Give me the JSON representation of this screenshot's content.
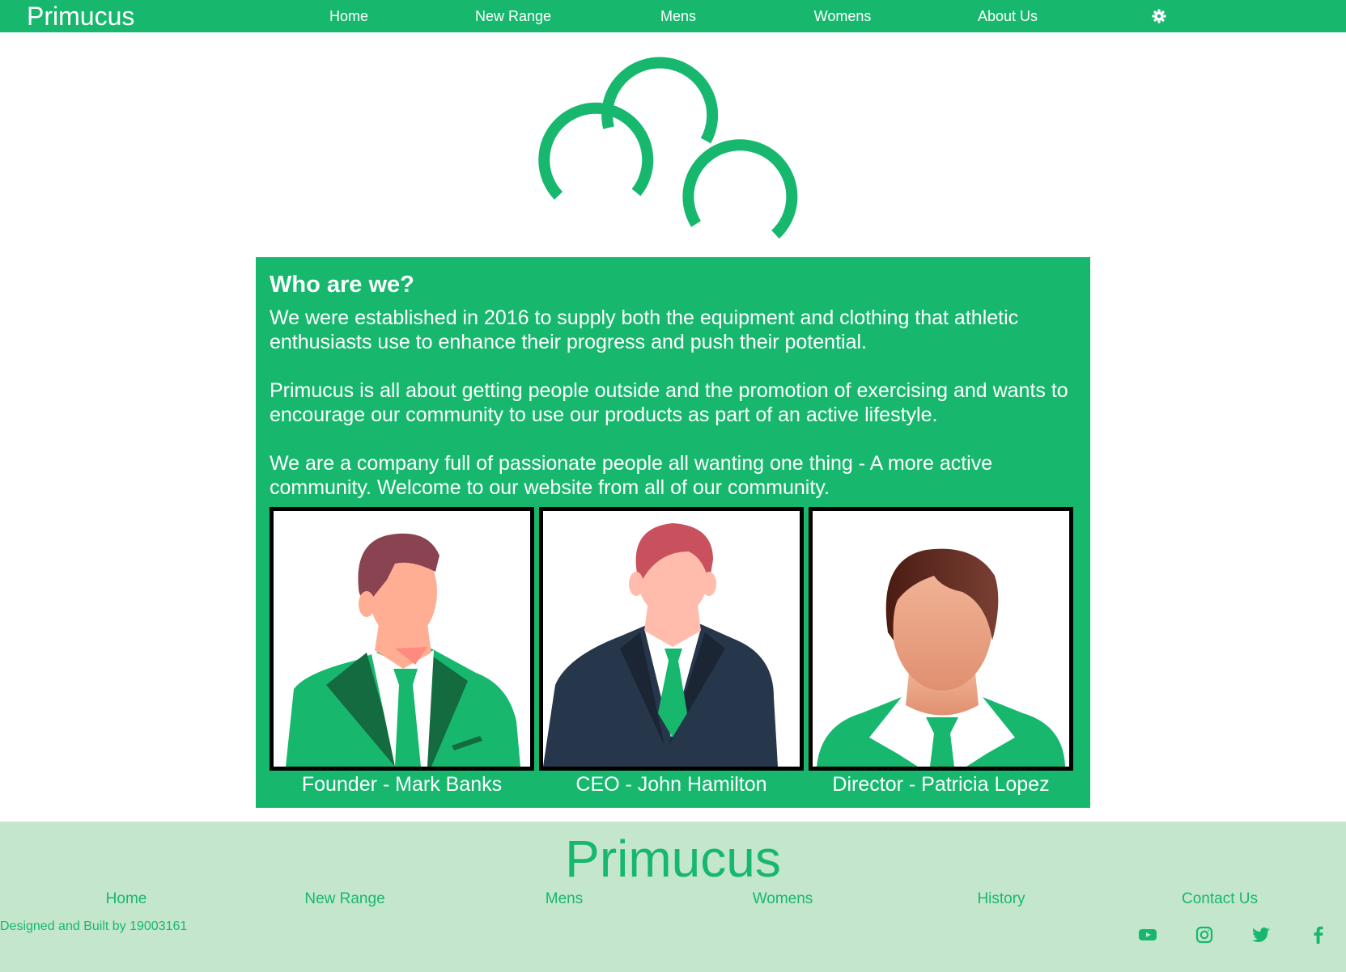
{
  "colors": {
    "brand_green": "#17b86e",
    "footer_bg": "#c4e6cc",
    "text_white": "#ffffff",
    "frame_black": "#000000"
  },
  "nav": {
    "brand": "Primucus",
    "items": [
      {
        "label": "Home"
      },
      {
        "label": "New Range"
      },
      {
        "label": "Mens"
      },
      {
        "label": "Womens"
      },
      {
        "label": "About Us"
      }
    ],
    "settings_icon": "gear-icon"
  },
  "logo": {
    "icon": "three-rings-logo"
  },
  "about": {
    "title": "Who are we?",
    "paragraphs": [
      "We were established in 2016 to supply both the equipment and clothing that athletic enthusiasts use to enhance their progress and push their potential.",
      "Primucus is all about getting people outside and the promotion of exercising and wants to encourage our community to use our products as part of an active lifestyle.",
      "We are a company full of passionate people all wanting one thing - A more active community. Welcome to our website from all of our community."
    ],
    "team": [
      {
        "caption": "Founder - Mark Banks",
        "icon": "man-green-suit-avatar"
      },
      {
        "caption": "CEO - John Hamilton",
        "icon": "man-navy-suit-avatar"
      },
      {
        "caption": "Director - Patricia Lopez",
        "icon": "person-green-collar-avatar"
      }
    ]
  },
  "footer": {
    "brand": "Primucus",
    "links": [
      {
        "label": "Home"
      },
      {
        "label": "New Range"
      },
      {
        "label": "Mens"
      },
      {
        "label": "Womens"
      },
      {
        "label": "History"
      },
      {
        "label": "Contact Us"
      }
    ],
    "credit": "Designed and Built by 19003161",
    "social": [
      {
        "icon": "youtube-icon"
      },
      {
        "icon": "instagram-icon"
      },
      {
        "icon": "twitter-icon"
      },
      {
        "icon": "facebook-icon"
      }
    ]
  }
}
